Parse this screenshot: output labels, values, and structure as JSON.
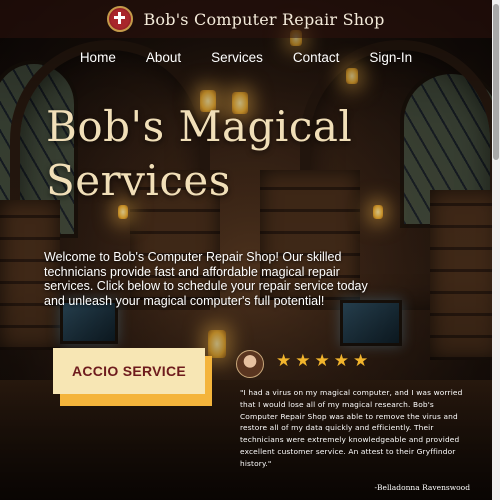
{
  "header": {
    "brand": "Bob's Computer Repair Shop",
    "logo_icon": "red-cross-shield-icon"
  },
  "nav": {
    "items": [
      {
        "label": "Home"
      },
      {
        "label": "About"
      },
      {
        "label": "Services"
      },
      {
        "label": "Contact"
      },
      {
        "label": "Sign-In"
      }
    ]
  },
  "hero": {
    "title_line1": "Bob's Magical",
    "title_line2": "Services",
    "intro": "Welcome to Bob's Computer Repair Shop! Our skilled technicians provide fast and affordable magical repair services. Click below to schedule your repair service today and unleash your magical computer's full potential!",
    "cta_label": "ACCIO SERVICE"
  },
  "testimonial": {
    "rating": 5,
    "max_rating": 5,
    "quote": "\"I had a virus on my magical computer, and I was worried that I would lose all of my magical research. Bob's Computer Repair Shop was able to remove the virus and restore all of my data quickly and efficiently. Their technicians were extremely knowledgeable and provided excellent customer service. An attest to their Gryffindor history.\"",
    "author": "-Belladonna Ravenswood"
  },
  "colors": {
    "title": "#f1dfb8",
    "cta_bg": "#f7e6b4",
    "cta_shadow": "#f4b43b",
    "cta_text": "#6e1b1d",
    "star": "#f2b52d"
  }
}
